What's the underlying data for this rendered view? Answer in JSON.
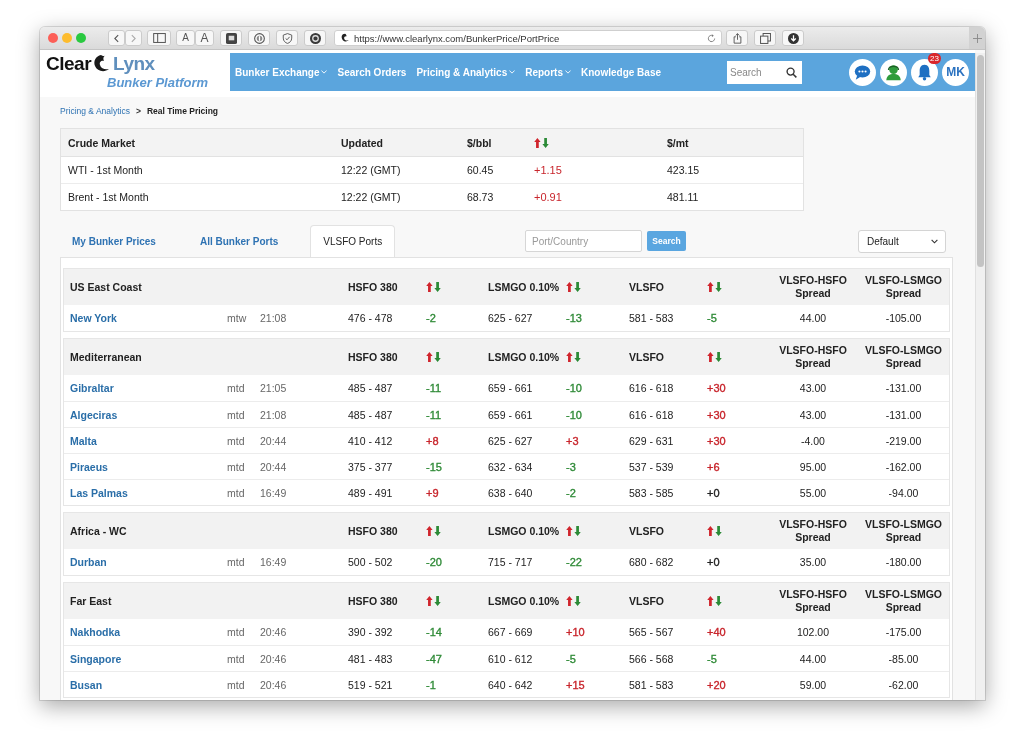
{
  "browser": {
    "text_size_buttons": [
      "A",
      "A"
    ],
    "url": "https://www.clearlynx.com/BunkerPrice/PortPrice"
  },
  "header": {
    "logo": {
      "word_1": "Clear",
      "word_2": "Lynx",
      "tagline": "Bunker Platform"
    },
    "nav": [
      {
        "label": "Bunker Exchange",
        "dropdown": true
      },
      {
        "label": "Search Orders",
        "dropdown": false
      },
      {
        "label": "Pricing & Analytics",
        "dropdown": true
      },
      {
        "label": "Reports",
        "dropdown": true
      },
      {
        "label": "Knowledge Base",
        "dropdown": false
      }
    ],
    "search": {
      "placeholder": "Search"
    },
    "notification_count": "23",
    "avatar": "MK"
  },
  "breadcrumb": {
    "items": [
      {
        "label": "Pricing & Analytics",
        "current": false
      },
      {
        "label": "Real Time Pricing",
        "current": true
      }
    ],
    "separator": ">"
  },
  "crude_market": {
    "columns": [
      {
        "kind": "text",
        "label": "Crude Market"
      },
      {
        "kind": "text",
        "label": "Updated"
      },
      {
        "kind": "text",
        "label": "$/bbl"
      },
      {
        "kind": "arrows"
      },
      {
        "kind": "text",
        "label": "$/mt"
      }
    ],
    "rows": [
      {
        "market": "WTI - 1st Month",
        "updated": "12:22 (GMT)",
        "per_bbl": "60.45",
        "change": "+1.15",
        "color": "#c8252c",
        "per_mt": "423.15"
      },
      {
        "market": "Brent - 1st Month",
        "updated": "12:22 (GMT)",
        "per_bbl": "68.73",
        "change": "+0.91",
        "color": "#c8252c",
        "per_mt": "481.11"
      }
    ]
  },
  "tabs": [
    {
      "label": "My Bunker Prices",
      "selected": false
    },
    {
      "label": "All Bunker Ports",
      "selected": false
    },
    {
      "label": "VLSFO Ports",
      "selected": true
    }
  ],
  "filters": {
    "port_search": {
      "placeholder": "Port/Country"
    },
    "search_button": "Search",
    "sort_select": "Default"
  },
  "port_table": {
    "groups": [
      {
        "region": "US East Coast",
        "columns": [
          {
            "kind": "label",
            "label": "HSFO 380"
          },
          {
            "kind": "arrows"
          },
          {
            "kind": "label",
            "label": "LSMGO 0.10%"
          },
          {
            "kind": "arrows"
          },
          {
            "kind": "label",
            "label": "VLSFO"
          },
          {
            "kind": "arrows"
          },
          {
            "kind": "spread",
            "label": "VLSFO-HSFO Spread"
          },
          {
            "kind": "spread",
            "label": "VLSFO-LSMGO Spread"
          }
        ],
        "rows": [
          {
            "port": "New York",
            "unit": "mtw",
            "time": "21:08",
            "prices": [
              {
                "range": "476 - 478",
                "change": "-2",
                "color": "#2f8a37"
              },
              {
                "range": "625 - 627",
                "change": "-13",
                "color": "#2f8a37"
              },
              {
                "range": "581 - 583",
                "change": "-5",
                "color": "#2f8a37"
              }
            ],
            "spread_hsfo": "44.00",
            "spread_lsmgo": "-105.00"
          }
        ]
      },
      {
        "region": "Mediterranean",
        "columns": [
          {
            "kind": "label",
            "label": "HSFO 380"
          },
          {
            "kind": "arrows"
          },
          {
            "kind": "label",
            "label": "LSMGO 0.10%"
          },
          {
            "kind": "arrows"
          },
          {
            "kind": "label",
            "label": "VLSFO"
          },
          {
            "kind": "arrows"
          },
          {
            "kind": "spread",
            "label": "VLSFO-HSFO Spread"
          },
          {
            "kind": "spread",
            "label": "VLSFO-LSMGO Spread"
          }
        ],
        "rows": [
          {
            "port": "Gibraltar",
            "unit": "mtd",
            "time": "21:05",
            "prices": [
              {
                "range": "485 - 487",
                "change": "-11",
                "color": "#2f8a37"
              },
              {
                "range": "659 - 661",
                "change": "-10",
                "color": "#2f8a37"
              },
              {
                "range": "616 - 618",
                "change": "+30",
                "color": "#c8252c"
              }
            ],
            "spread_hsfo": "43.00",
            "spread_lsmgo": "-131.00"
          },
          {
            "port": "Algeciras",
            "unit": "mtd",
            "time": "21:08",
            "prices": [
              {
                "range": "485 - 487",
                "change": "-11",
                "color": "#2f8a37"
              },
              {
                "range": "659 - 661",
                "change": "-10",
                "color": "#2f8a37"
              },
              {
                "range": "616 - 618",
                "change": "+30",
                "color": "#c8252c"
              }
            ],
            "spread_hsfo": "43.00",
            "spread_lsmgo": "-131.00"
          },
          {
            "port": "Malta",
            "unit": "mtd",
            "time": "20:44",
            "prices": [
              {
                "range": "410 - 412",
                "change": "+8",
                "color": "#c8252c"
              },
              {
                "range": "625 - 627",
                "change": "+3",
                "color": "#c8252c"
              },
              {
                "range": "629 - 631",
                "change": "+30",
                "color": "#c8252c"
              }
            ],
            "spread_hsfo": "-4.00",
            "spread_lsmgo": "-219.00"
          },
          {
            "port": "Piraeus",
            "unit": "mtd",
            "time": "20:44",
            "prices": [
              {
                "range": "375 - 377",
                "change": "-15",
                "color": "#2f8a37"
              },
              {
                "range": "632 - 634",
                "change": "-3",
                "color": "#2f8a37"
              },
              {
                "range": "537 - 539",
                "change": "+6",
                "color": "#c8252c"
              }
            ],
            "spread_hsfo": "95.00",
            "spread_lsmgo": "-162.00"
          },
          {
            "port": "Las Palmas",
            "unit": "mtd",
            "time": "16:49",
            "prices": [
              {
                "range": "489 - 491",
                "change": "+9",
                "color": "#c8252c"
              },
              {
                "range": "638 - 640",
                "change": "-2",
                "color": "#2f8a37"
              },
              {
                "range": "583 - 585",
                "change": "+0",
                "color": "#222222"
              }
            ],
            "spread_hsfo": "55.00",
            "spread_lsmgo": "-94.00"
          }
        ]
      },
      {
        "region": "Africa - WC",
        "columns": [
          {
            "kind": "label",
            "label": "HSFO 380"
          },
          {
            "kind": "arrows"
          },
          {
            "kind": "label",
            "label": "LSMGO 0.10%"
          },
          {
            "kind": "arrows"
          },
          {
            "kind": "label",
            "label": "VLSFO"
          },
          {
            "kind": "arrows"
          },
          {
            "kind": "spread",
            "label": "VLSFO-HSFO Spread"
          },
          {
            "kind": "spread",
            "label": "VLSFO-LSMGO Spread"
          }
        ],
        "rows": [
          {
            "port": "Durban",
            "unit": "mtd",
            "time": "16:49",
            "prices": [
              {
                "range": "500 - 502",
                "change": "-20",
                "color": "#2f8a37"
              },
              {
                "range": "715 - 717",
                "change": "-22",
                "color": "#2f8a37"
              },
              {
                "range": "680 - 682",
                "change": "+0",
                "color": "#222222"
              }
            ],
            "spread_hsfo": "35.00",
            "spread_lsmgo": "-180.00"
          }
        ]
      },
      {
        "region": "Far East",
        "columns": [
          {
            "kind": "label",
            "label": "HSFO 380"
          },
          {
            "kind": "arrows"
          },
          {
            "kind": "label",
            "label": "LSMGO 0.10%"
          },
          {
            "kind": "arrows"
          },
          {
            "kind": "label",
            "label": "VLSFO"
          },
          {
            "kind": "arrows"
          },
          {
            "kind": "spread",
            "label": "VLSFO-HSFO Spread"
          },
          {
            "kind": "spread",
            "label": "VLSFO-LSMGO Spread"
          }
        ],
        "rows": [
          {
            "port": "Nakhodka",
            "unit": "mtd",
            "time": "20:46",
            "prices": [
              {
                "range": "390 - 392",
                "change": "-14",
                "color": "#2f8a37"
              },
              {
                "range": "667 - 669",
                "change": "+10",
                "color": "#c8252c"
              },
              {
                "range": "565 - 567",
                "change": "+40",
                "color": "#c8252c"
              }
            ],
            "spread_hsfo": "102.00",
            "spread_lsmgo": "-175.00"
          },
          {
            "port": "Singapore",
            "unit": "mtd",
            "time": "20:46",
            "prices": [
              {
                "range": "481 - 483",
                "change": "-47",
                "color": "#2f8a37"
              },
              {
                "range": "610 - 612",
                "change": "-5",
                "color": "#2f8a37"
              },
              {
                "range": "566 - 568",
                "change": "-5",
                "color": "#2f8a37"
              }
            ],
            "spread_hsfo": "44.00",
            "spread_lsmgo": "-85.00"
          },
          {
            "port": "Busan",
            "unit": "mtd",
            "time": "20:46",
            "prices": [
              {
                "range": "519 - 521",
                "change": "-1",
                "color": "#2f8a37"
              },
              {
                "range": "640 - 642",
                "change": "+15",
                "color": "#c8252c"
              },
              {
                "range": "581 - 583",
                "change": "+20",
                "color": "#c8252c"
              }
            ],
            "spread_hsfo": "59.00",
            "spread_lsmgo": "-62.00"
          }
        ]
      }
    ]
  }
}
